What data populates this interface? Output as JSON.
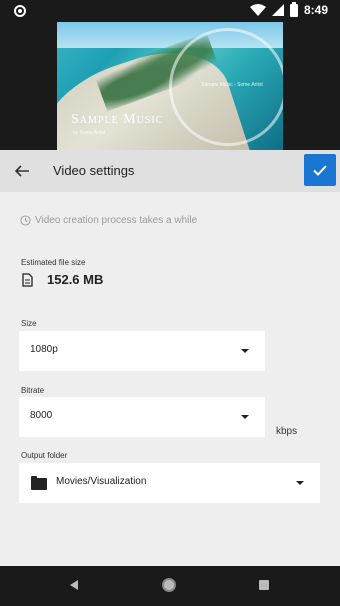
{
  "status_bar": {
    "time": "8:49"
  },
  "preview": {
    "ring_label": "Sample Music - Some Artist",
    "title": "Sample Music",
    "subtitle": "by Some Artist"
  },
  "toolbar": {
    "title": "Video settings"
  },
  "notice": "Video creation process takes a while",
  "file_size": {
    "label": "Estimated file size",
    "value": "152.6 MB"
  },
  "size": {
    "label": "Size",
    "selected": "1080p"
  },
  "bitrate": {
    "label": "Bitrate",
    "selected": "8000",
    "unit": "kbps"
  },
  "output_folder": {
    "label": "Output folder",
    "selected": "Movies/Visualization"
  }
}
